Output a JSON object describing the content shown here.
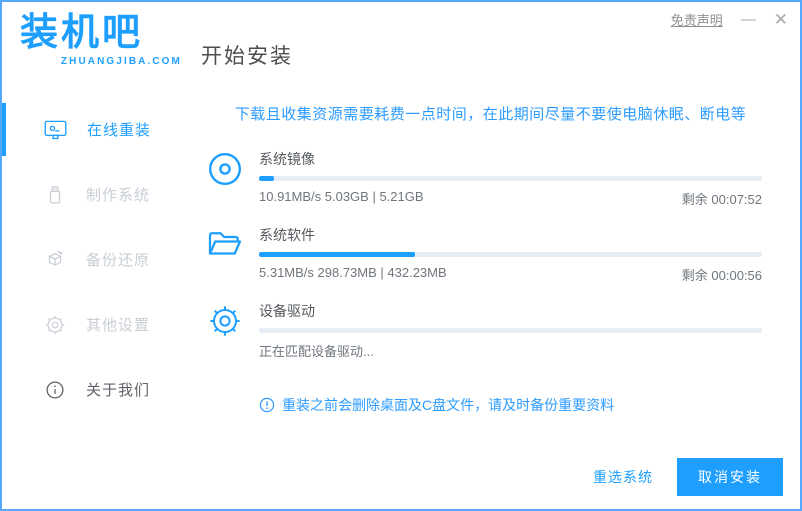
{
  "window": {
    "logo_text": "装机吧",
    "logo_domain": "ZHUANGJIBA.COM",
    "page_title": "开始安装",
    "disclaimer_label": "免责声明",
    "minimize_glyph": "—",
    "close_glyph": "✕"
  },
  "colors": {
    "accent": "#1e9fff",
    "warning_text": "#2d9cff",
    "progress_track": "#e7edf5",
    "disabled_item": "#c9ced6",
    "window_border": "#55a9ff"
  },
  "sidebar": {
    "items": [
      {
        "label": "在线重装",
        "icon": "monitor-reinstall-icon",
        "state": "active"
      },
      {
        "label": "制作系统",
        "icon": "usb-drive-icon",
        "state": "disabled"
      },
      {
        "label": "备份还原",
        "icon": "backup-restore-icon",
        "state": "disabled"
      },
      {
        "label": "其他设置",
        "icon": "gear-icon",
        "state": "disabled"
      },
      {
        "label": "关于我们",
        "icon": "info-icon",
        "state": "normal"
      }
    ]
  },
  "main": {
    "warning": "下载且收集资源需要耗费一点时间，在此期间尽量不要使电脑休眠、断电等",
    "tasks": [
      {
        "icon": "disc-icon",
        "label": "系统镜像",
        "progress_percent": 3,
        "stats": "10.91MB/s 5.03GB | 5.21GB",
        "remaining": "剩余 00:07:52"
      },
      {
        "icon": "folder-icon",
        "label": "系统软件",
        "progress_percent": 31,
        "stats": "5.31MB/s 298.73MB | 432.23MB",
        "remaining": "剩余 00:00:56"
      },
      {
        "icon": "gear-icon",
        "label": "设备驱动",
        "progress_percent": 0,
        "stats": "正在匹配设备驱动...",
        "remaining": ""
      }
    ],
    "note": "重装之前会删除桌面及C盘文件，请及时备份重要资料"
  },
  "footer": {
    "reselect_label": "重选系统",
    "cancel_label": "取消安装"
  }
}
